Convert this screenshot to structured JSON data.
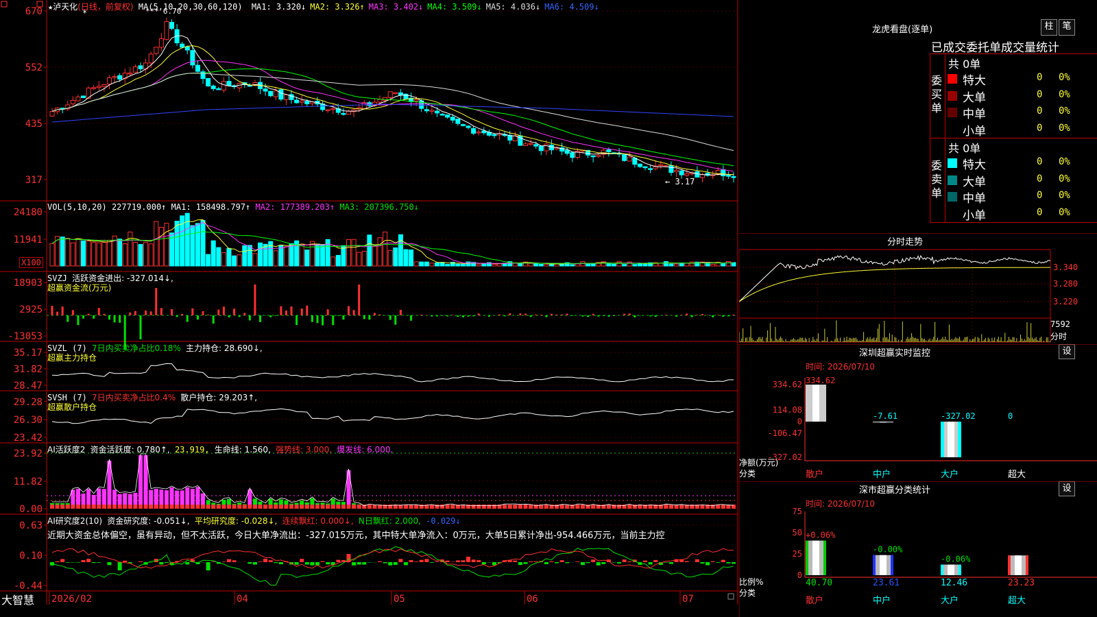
{
  "stock": {
    "name": "泸天化",
    "mode": "(日线，前复权)",
    "ma_label": "MA(5,10,20,30,60,120)",
    "ma": [
      {
        "label": "MA1:",
        "value": "3.320↓",
        "color": "#ffffff"
      },
      {
        "label": "MA2:",
        "value": "3.326↑",
        "color": "#ffff33"
      },
      {
        "label": "MA3:",
        "value": "3.402↓",
        "color": "#ff33ff"
      },
      {
        "label": "MA4:",
        "value": "3.509↓",
        "color": "#00ff00"
      },
      {
        "label": "MA5:",
        "value": "4.036↓",
        "color": "#dddddd"
      },
      {
        "label": "MA6:",
        "value": "4.509↓",
        "color": "#3366ff"
      }
    ],
    "y_ticks": [
      "670",
      "552",
      "435",
      "317"
    ],
    "high_label": "6.70",
    "low_label": "← 3.17",
    "marker_stars": "***"
  },
  "vol": {
    "title": "VOL(5,10,20)",
    "value": "227719.000↑",
    "ma1": "MA1: 158498.797↑",
    "ma2": "MA2: 177389.203↑",
    "ma3": "MA3: 207396.750↓",
    "y_ticks": [
      "24180",
      "11941"
    ],
    "unit": "X100"
  },
  "svzj": {
    "title": "SVZJ",
    "label": "活跃资金进出: -327.014↓,",
    "subtitle": "超赢资金流(万元)",
    "y_ticks": [
      "18903",
      "2925",
      "-13053"
    ]
  },
  "svzl": {
    "title": "SVZL (7)",
    "label": "7日内买卖净占比0.18%",
    "extra": "主力持仓: 28.690↓,",
    "subtitle": "超赢主力持仓",
    "y_ticks": [
      "35.17",
      "31.82",
      "28.47"
    ]
  },
  "svsh": {
    "title": "SVSH (7)",
    "label": "7日内买卖净占比0.4%",
    "extra": "散户持仓: 29.203↑,",
    "subtitle": "超赢散户持仓",
    "y_ticks": [
      "29.28",
      "26.30",
      "23.42"
    ]
  },
  "ai2": {
    "title": "AI活跃度2",
    "label": "资金活跃度: 0.780↑,",
    "val2": "23.919,",
    "life": "生命线: 1.560,",
    "strong": "强势线: 3.000,",
    "burst": "爆发线: 6.000,",
    "y_ticks": [
      "23.92",
      "11.82",
      "0.00"
    ]
  },
  "ai_res": {
    "title": "AI研究度2(10)",
    "label": "资金研究度: -0.051↓,",
    "avg": "平均研究度: -0.028↓,",
    "cont": "连续飘红: 0.000↓,",
    "nday": "N日飘红: 2.000,",
    "last": "-0.029↓",
    "commentary": "近期大资金总体偏空，虽有异动，但不太活跃，今日大单净流出：-327.015万元，其中特大单净流入：0万元，大单5日累计净出-954.466万元，当前主力控",
    "y_ticks": [
      "0.63",
      "0.10",
      "-0.44"
    ]
  },
  "xaxis": {
    "labels": [
      "2026/02",
      "04",
      "05",
      "06",
      "07"
    ],
    "brand": "大智慧"
  },
  "dragon": {
    "title": "龙虎看盘(逐单)",
    "btn1": "柱",
    "btn2": "笔",
    "heading": "已成交委托单成交量统计",
    "buy_label": "委买单",
    "sell_label": "委卖单",
    "buy_total": "共 0单",
    "sell_total": "共 0单",
    "buy_rows": [
      {
        "name": "特大",
        "count": "0",
        "pct": "0%",
        "color": "#ff0000"
      },
      {
        "name": "大单",
        "count": "0",
        "pct": "0%",
        "color": "#990000"
      },
      {
        "name": "中单",
        "count": "0",
        "pct": "0%",
        "color": "#660000"
      },
      {
        "name": "小单",
        "count": "0",
        "pct": "0%",
        "color": "#000000"
      }
    ],
    "sell_rows": [
      {
        "name": "特大",
        "count": "0",
        "pct": "0%",
        "color": "#00ffff"
      },
      {
        "name": "大单",
        "count": "0",
        "pct": "0%",
        "color": "#008888"
      },
      {
        "name": "中单",
        "count": "0",
        "pct": "0%",
        "color": "#006666"
      },
      {
        "name": "小单",
        "count": "0",
        "pct": "0%",
        "color": "#000000"
      }
    ]
  },
  "intraday": {
    "title": "分时走势",
    "y_ticks": [
      "3.340",
      "3.280",
      "3.220"
    ],
    "vol_label": "7592",
    "foot": "分时"
  },
  "monitor": {
    "title": "深圳超赢实时监控",
    "btn": "设",
    "time": "时间: 2026/07/10",
    "y_ticks": [
      "334.62",
      "114.08",
      "0",
      "-106.47",
      "-327.02"
    ],
    "values": [
      {
        "cat": "散户",
        "val": 334.62,
        "text": "334.62"
      },
      {
        "cat": "中户",
        "val": -7.61,
        "text": "-7.61"
      },
      {
        "cat": "大户",
        "val": -327.02,
        "text": "-327.02"
      },
      {
        "cat": "超大",
        "val": 0,
        "text": "0"
      }
    ],
    "left_label1": "净额(万元)",
    "left_label2": "分类"
  },
  "classify": {
    "title": "深市超赢分类统计",
    "btn": "设",
    "time": "时间: 2026/07/10",
    "y_ticks": [
      "75",
      "50",
      "25",
      "0"
    ],
    "values": [
      {
        "cat": "散户",
        "val": 40.7,
        "text": "40.70",
        "change": "+0.06%"
      },
      {
        "cat": "中户",
        "val": 23.61,
        "text": "23.61",
        "change": "-0.00%"
      },
      {
        "cat": "大户",
        "val": 12.46,
        "text": "12.46",
        "change": "-0.06%"
      },
      {
        "cat": "超大",
        "val": 23.23,
        "text": "23.23",
        "change": ""
      }
    ],
    "left_label1": "比例%",
    "left_label2": "分类"
  },
  "colors": {
    "up": "#ff3030",
    "down": "#00ffff",
    "grid": "#c00000"
  }
}
